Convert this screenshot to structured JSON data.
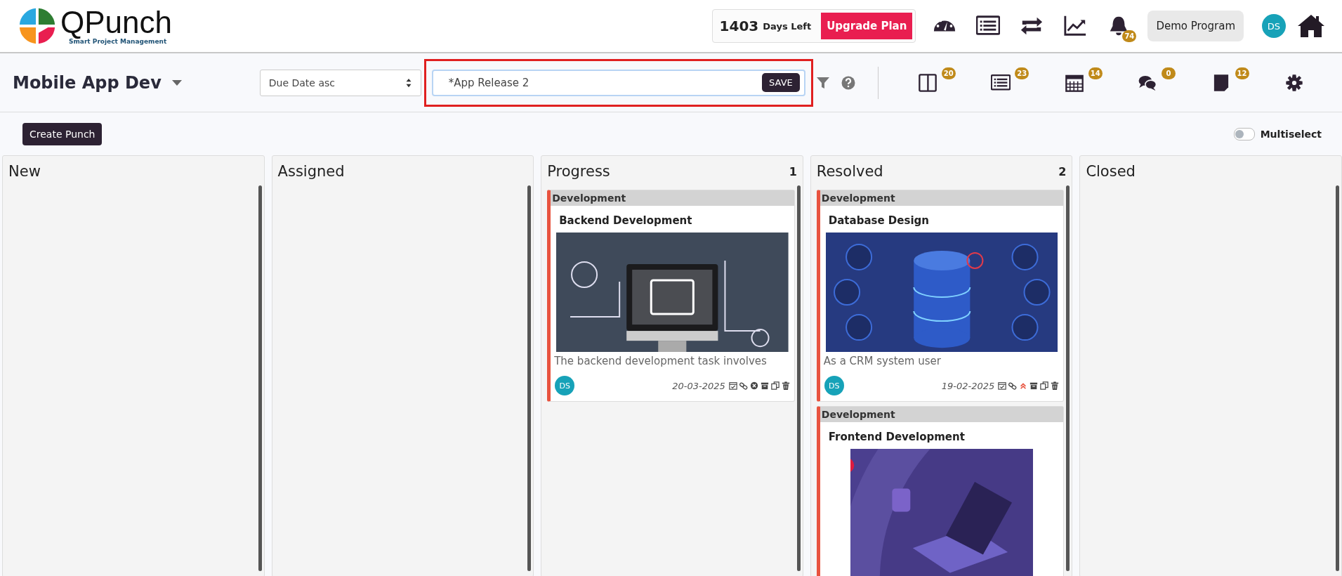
{
  "header": {
    "logo": {
      "name": "QPunch",
      "tagline": "Smart Project Management"
    },
    "subscription": {
      "days": "1403",
      "days_label": "Days Left",
      "upgrade": "Upgrade Plan"
    },
    "nav_icons": [
      {
        "kind": "dashboard"
      },
      {
        "kind": "list"
      },
      {
        "kind": "sync"
      },
      {
        "kind": "chart"
      },
      {
        "kind": "bell",
        "badge": "74"
      }
    ],
    "program": "Demo Program",
    "user_initials": "DS"
  },
  "toolbar": {
    "project": "Mobile App Dev",
    "sort": "Due Date asc",
    "filter_name": "*App Release 2",
    "save": "SAVE",
    "views": [
      {
        "kind": "board",
        "badge": "20"
      },
      {
        "kind": "list",
        "badge": "23"
      },
      {
        "kind": "calendar",
        "badge": "14"
      },
      {
        "kind": "chat",
        "badge": "0"
      },
      {
        "kind": "note",
        "badge": "12"
      },
      {
        "kind": "settings"
      }
    ]
  },
  "create_button": "Create Punch",
  "multiselect": {
    "label": "Multiselect",
    "on": false
  },
  "columns": [
    {
      "title": "New"
    },
    {
      "title": "Assigned"
    },
    {
      "title": "Progress",
      "count": "1",
      "cards": [
        {
          "category": "Development",
          "title": "Backend Development",
          "description": "The backend development task involves",
          "assignee": "DS",
          "due": "20-03-2025",
          "actions": [
            {
              "kind": "schedule"
            },
            {
              "kind": "link"
            },
            {
              "kind": "cancel"
            },
            {
              "kind": "archive"
            },
            {
              "kind": "copy"
            },
            {
              "kind": "delete"
            }
          ]
        }
      ]
    },
    {
      "title": "Resolved",
      "count": "2",
      "cards": [
        {
          "category": "Development",
          "title": "Database Design",
          "description": "As a CRM system user",
          "assignee": "DS",
          "due": "19-02-2025",
          "actions": [
            {
              "kind": "schedule"
            },
            {
              "kind": "link"
            },
            {
              "kind": "priority"
            },
            {
              "kind": "archive"
            },
            {
              "kind": "copy"
            },
            {
              "kind": "delete"
            }
          ]
        },
        {
          "category": "Development",
          "title": "Frontend Development"
        }
      ]
    },
    {
      "title": "Closed"
    }
  ]
}
